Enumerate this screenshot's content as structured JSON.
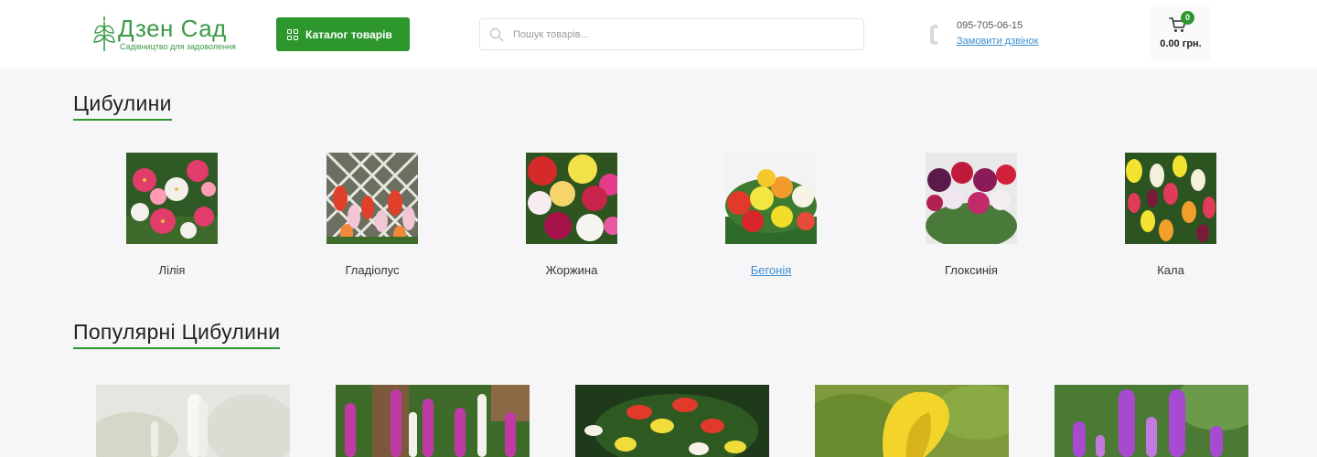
{
  "header": {
    "logo_title": "Дзен Сад",
    "logo_subtitle": "Садівництво для задоволення",
    "catalog_button": "Каталог товарів",
    "search_placeholder": "Пошук товарів...",
    "phone": "095-705-06-15",
    "callback": "Замовити дзвінок",
    "cart_count": "0",
    "cart_total": "0.00 грн."
  },
  "sections": {
    "bulbs_title": "Цибулини",
    "popular_title": "Популярні Цибулини"
  },
  "categories": [
    {
      "label": "Лілія",
      "icon": "lily-photo"
    },
    {
      "label": "Гладіолус",
      "icon": "gladiolus-photo"
    },
    {
      "label": "Жоржина",
      "icon": "dahlia-photo"
    },
    {
      "label": "Бегонія",
      "icon": "begonia-photo"
    },
    {
      "label": "Глоксинія",
      "icon": "gloxinia-photo"
    },
    {
      "label": "Кала",
      "icon": "calla-photo"
    }
  ],
  "products": [
    {
      "icon": "white-liatris-photo"
    },
    {
      "icon": "pink-liatris-photo"
    },
    {
      "icon": "tree-lily-photo"
    },
    {
      "icon": "yellow-calla-photo"
    },
    {
      "icon": "purple-liatris-photo"
    }
  ],
  "colors": {
    "accent": "#2d962d",
    "brand": "#3a9a46",
    "link": "#3d8fd0",
    "background": "#f6f6f9"
  }
}
